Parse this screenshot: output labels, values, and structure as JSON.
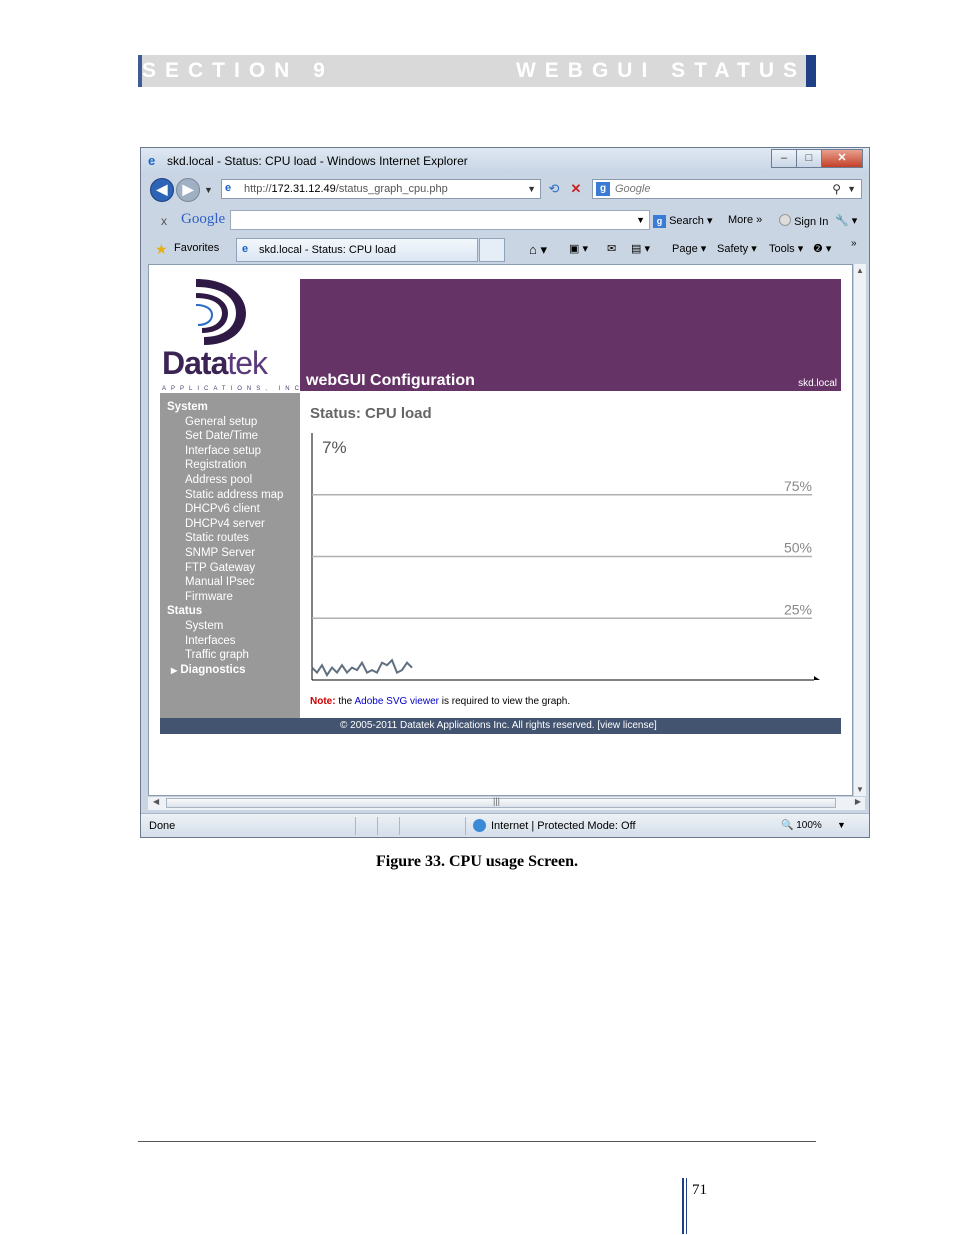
{
  "section_header": {
    "left": "SECTION 9",
    "right": "WEBGUI STATUS"
  },
  "browser": {
    "window_title": "skd.local - Status: CPU load - Windows Internet Explorer",
    "window_buttons": {
      "minimize": "–",
      "maximize": "□",
      "close": "✕"
    },
    "address_url_prefix": "http://",
    "address_url_host": "172.31.12.49",
    "address_url_path": "/status_graph_cpu.php",
    "search_placeholder": "Google",
    "google_toolbar": {
      "close": "x",
      "logo": "Google",
      "search_button": "Search ▾",
      "more": "More »",
      "sign_in": "Sign In",
      "wrench": "🔧 ▾"
    },
    "favorites_label": "Favorites",
    "tab_title": "skd.local - Status: CPU load",
    "command_bar": [
      "Page ▾",
      "Safety ▾",
      "Tools ▾",
      "❷ ▾"
    ],
    "status_bar": {
      "left": "Done",
      "zone": "Internet | Protected Mode: Off",
      "zoom": "🔍 100%"
    }
  },
  "webgui": {
    "logo_text_bold": "Data",
    "logo_text_light": "tek",
    "logo_subtext": "APPLICATIONS, INC",
    "banner_title": "webGUI Configuration",
    "hostname": "skd.local",
    "menu": {
      "system_header": "System",
      "system_items": [
        "General setup",
        "Set Date/Time",
        "Interface setup",
        "Registration",
        "Address pool",
        "Static address map",
        "DHCPv6 client",
        "DHCPv4 server",
        "Static routes",
        "SNMP Server",
        "FTP Gateway",
        "Manual IPsec",
        "Firmware"
      ],
      "status_header": "Status",
      "status_items": [
        "System",
        "Interfaces",
        "Traffic graph"
      ],
      "diagnostics": "Diagnostics"
    },
    "page_title": "Status: CPU load",
    "note_label": "Note:",
    "note_pre": " the ",
    "note_link": "Adobe SVG viewer",
    "note_post": " is required to view the graph.",
    "footer": "© 2005-2011 Datatek Applications Inc. All rights reserved.   [view license]"
  },
  "chart_data": {
    "type": "line",
    "title": "",
    "current_value_label": "7%",
    "gridlines": [
      "75%",
      "50%",
      "25%"
    ],
    "ylim": [
      0,
      100
    ],
    "series": [
      {
        "values": [
          5,
          3,
          6,
          2,
          5,
          3,
          6,
          3,
          5,
          4,
          7,
          3,
          4,
          3,
          7,
          6,
          8,
          3,
          4,
          7,
          5
        ]
      }
    ],
    "line_color": "#607080"
  },
  "caption": "Figure 33. CPU usage Screen.",
  "page_number": "71"
}
